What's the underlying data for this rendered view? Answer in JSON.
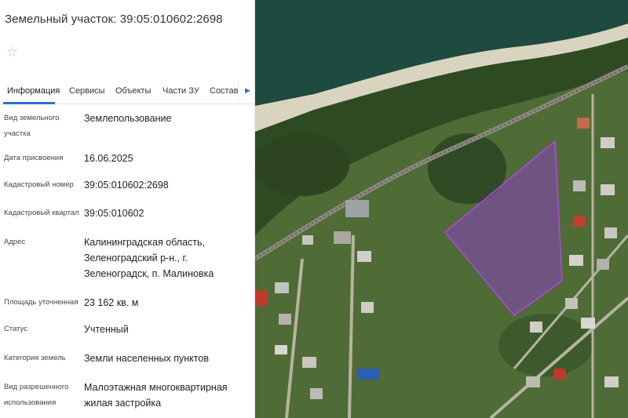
{
  "panel": {
    "title": "Земельный участок: 39:05:010602:2698",
    "favorite_icon": "star-icon",
    "tabs": [
      {
        "label": "Информация"
      },
      {
        "label": "Сервисы"
      },
      {
        "label": "Объекты"
      },
      {
        "label": "Части ЗУ"
      },
      {
        "label": "Состав"
      }
    ],
    "tabs_arrow_icon": "chevron-right-icon",
    "fields": [
      {
        "label": "Вид земельного участка",
        "value": "Землепользование"
      },
      {
        "label": "Дата присвоения",
        "value": "16.06.2025"
      },
      {
        "label": "Кадастровый номер",
        "value": "39:05:010602:2698"
      },
      {
        "label": "Кадастровый квартал",
        "value": "39:05:010602"
      },
      {
        "label": "Адрес",
        "value": "Калининградская область, Зеленоградский р-н., г. Зеленоградск, п. Малиновка"
      },
      {
        "label": "Площадь уточненная",
        "value": "23 162 кв. м"
      },
      {
        "label": "Статус",
        "value": "Учтенный"
      },
      {
        "label": "Категория земель",
        "value": "Земли населенных пунктов"
      },
      {
        "label": "Вид разрешенного использования",
        "value": "Малоэтажная многоквартирная жилая застройка"
      }
    ]
  },
  "colors": {
    "accent": "#2f6fd6",
    "parcel_fill": "#8a3fbf",
    "parcel_stroke": "#b04ae0"
  }
}
